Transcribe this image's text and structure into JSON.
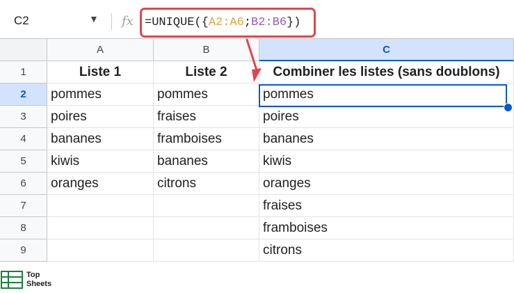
{
  "name_box": "C2",
  "formula": {
    "prefix": "=UNIQUE({",
    "range1": "A2:A6",
    "sep": ";",
    "range2": "B2:B6",
    "suffix": "})"
  },
  "fx_label": "fx",
  "columns": [
    "A",
    "B",
    "C"
  ],
  "rows": [
    "1",
    "2",
    "3",
    "4",
    "5",
    "6",
    "7",
    "8",
    "9"
  ],
  "cells": {
    "A": [
      "Liste 1",
      "pommes",
      "poires",
      "bananes",
      "kiwis",
      "oranges",
      "",
      "",
      ""
    ],
    "B": [
      "Liste 2",
      "pommes",
      "fraises",
      "framboises",
      "bananes",
      "citrons",
      "",
      "",
      ""
    ],
    "C": [
      "Combiner les listes (sans doublons)",
      "pommes",
      "poires",
      "bananes",
      "kiwis",
      "oranges",
      "fraises",
      "framboises",
      "citrons"
    ]
  },
  "logo": {
    "line1": "Top",
    "line2": "Sheets"
  },
  "colors": {
    "highlight": "#e0454f",
    "selection": "#0b57d0",
    "range1": "#e8a33d",
    "range2": "#9b59b6"
  }
}
